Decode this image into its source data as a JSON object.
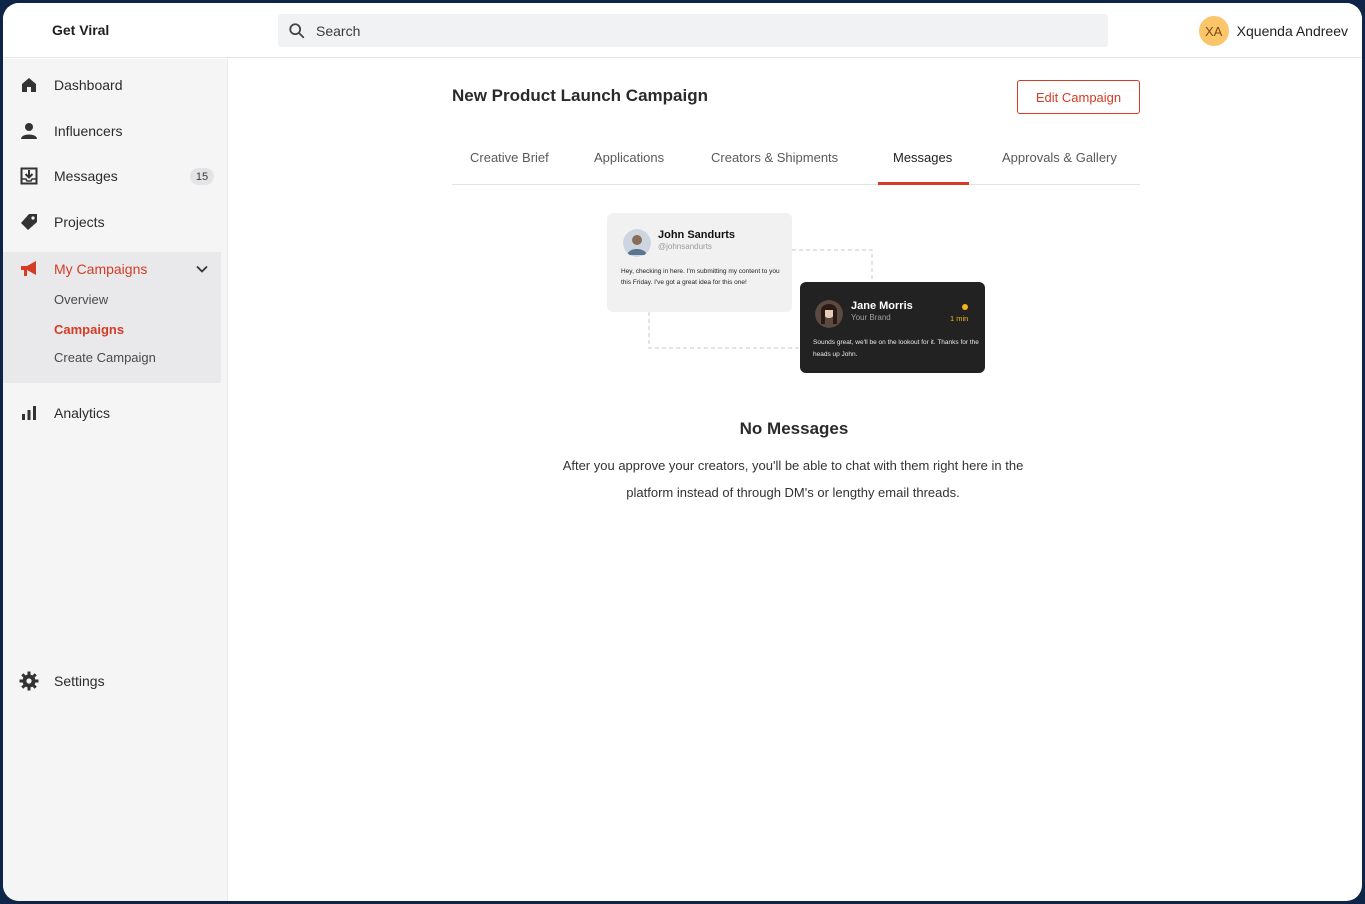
{
  "app": {
    "brand": "Get Viral"
  },
  "search": {
    "placeholder": "Search"
  },
  "user": {
    "initials": "XA",
    "name": "Xquenda Andreev"
  },
  "sidebar": {
    "items": [
      {
        "label": "Dashboard",
        "icon": "home-icon"
      },
      {
        "label": "Influencers",
        "icon": "person-icon"
      },
      {
        "label": "Messages",
        "icon": "inbox-icon",
        "badge": "15"
      },
      {
        "label": "Projects",
        "icon": "tag-icon"
      },
      {
        "label": "My Campaigns",
        "icon": "megaphone-icon",
        "expanded": true
      },
      {
        "label": "Analytics",
        "icon": "bar-chart-icon"
      },
      {
        "label": "Settings",
        "icon": "gear-icon"
      }
    ],
    "campaign_sub": [
      {
        "label": "Overview"
      },
      {
        "label": "Campaigns",
        "active": true
      },
      {
        "label": "Create Campaign"
      }
    ]
  },
  "main": {
    "title": "New Product Launch Campaign",
    "edit_label": "Edit Campaign",
    "tabs": [
      {
        "label": "Creative Brief"
      },
      {
        "label": "Applications"
      },
      {
        "label": "Creators & Shipments"
      },
      {
        "label": "Messages",
        "active": true
      },
      {
        "label": "Approvals & Gallery"
      }
    ]
  },
  "illustration": {
    "card1": {
      "name": "John Sandurts",
      "handle": "@johnsandurts",
      "message": "Hey, checking in here. I'm submitting my content to you this Friday. I've got a great idea for this one!"
    },
    "card2": {
      "name": "Jane Morris",
      "sub": "Your Brand",
      "time": "1 min",
      "message": "Sounds great, we'll be on the lookout for it. Thanks for the heads up John."
    }
  },
  "empty": {
    "title": "No Messages",
    "text": "After you approve your creators, you'll be able to chat with them right here in the platform instead of through DM's or lengthy email threads."
  },
  "colors": {
    "accent": "#d43c25",
    "frame": "#0f2547",
    "avatar_bg": "#fbc56a",
    "sidebar_bg": "#f5f5f6"
  }
}
